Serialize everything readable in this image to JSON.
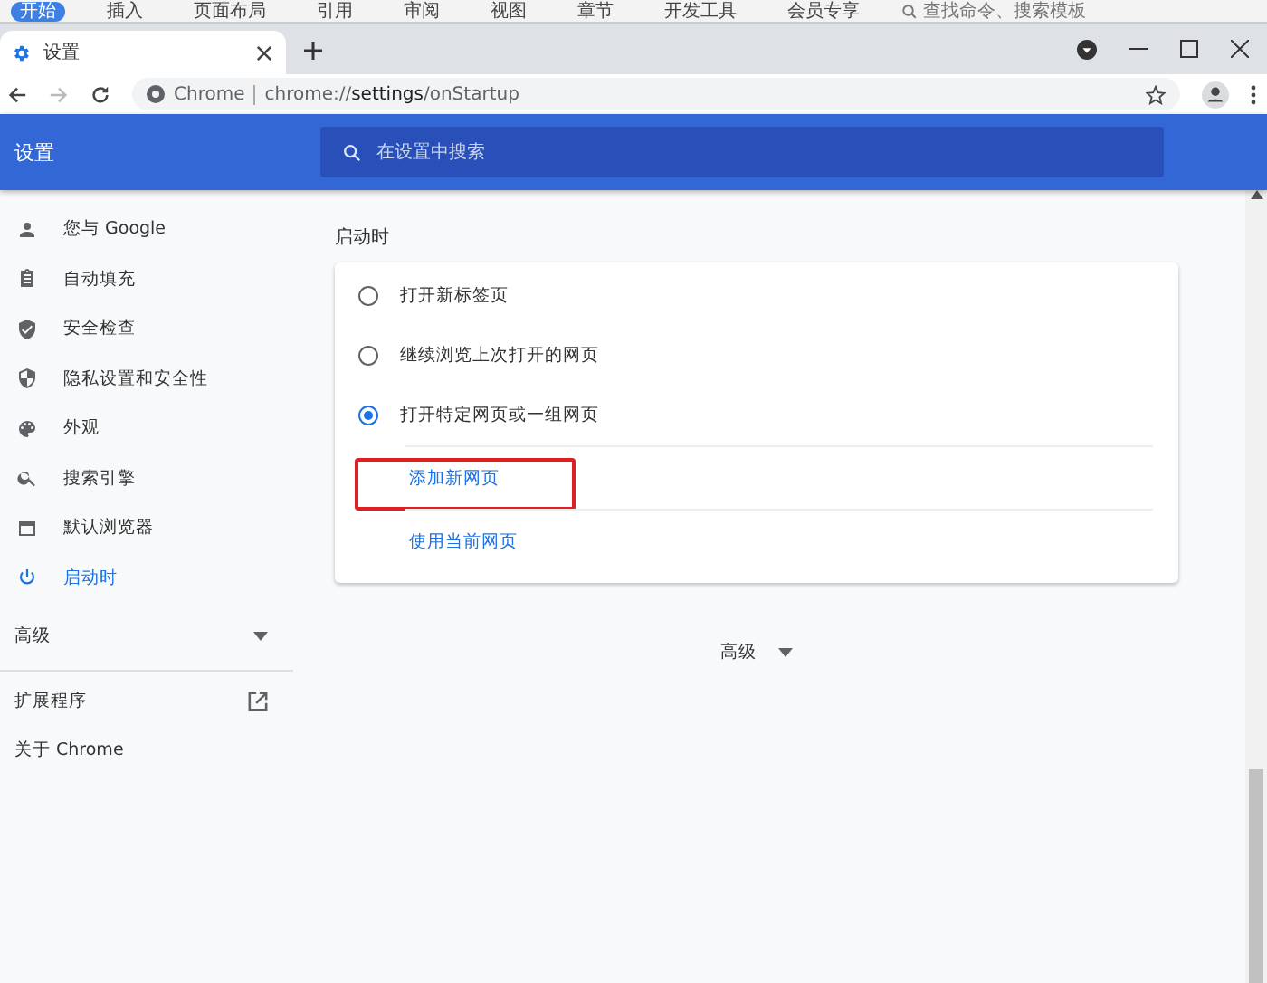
{
  "ribbon": {
    "tabs": [
      {
        "label": "开始",
        "selected": true
      },
      {
        "label": "插入",
        "selected": false
      },
      {
        "label": "页面布局",
        "selected": false
      },
      {
        "label": "引用",
        "selected": false
      },
      {
        "label": "审阅",
        "selected": false
      },
      {
        "label": "视图",
        "selected": false
      },
      {
        "label": "章节",
        "selected": false
      },
      {
        "label": "开发工具",
        "selected": false
      },
      {
        "label": "会员专享",
        "selected": false
      }
    ],
    "search": {
      "placeholder": "查找命令、搜索模板"
    }
  },
  "browser": {
    "tab": {
      "title": "设置"
    },
    "omnibox": {
      "site": "Chrome",
      "url": "chrome://**settings**/onStartup"
    },
    "forward_disabled": true
  },
  "header": {
    "title": "设置",
    "search": {
      "placeholder": "在设置中搜索"
    }
  },
  "sidebar": {
    "items": [
      {
        "label": "您与 Google",
        "selected": false
      },
      {
        "label": "自动填充",
        "selected": false
      },
      {
        "label": "安全检查",
        "selected": false
      },
      {
        "label": "隐私设置和安全性",
        "selected": false
      },
      {
        "label": "外观",
        "selected": false
      },
      {
        "label": "搜索引擎",
        "selected": false
      },
      {
        "label": "默认浏览器",
        "selected": false
      },
      {
        "label": "启动时",
        "selected": true
      }
    ],
    "advanced": {
      "label": "高级",
      "expanded": false
    },
    "extensions": "扩展程序",
    "about": "关于 Chrome"
  },
  "main": {
    "section_title": "启动时",
    "options": [
      {
        "label": "打开新标签页",
        "selected": false
      },
      {
        "label": "继续浏览上次打开的网页",
        "selected": false
      },
      {
        "label": "打开特定网页或一组网页",
        "selected": true
      }
    ],
    "links": [
      {
        "label": "添加新网页",
        "highlighted": true
      },
      {
        "label": "使用当前网页",
        "highlighted": false
      }
    ],
    "advanced": {
      "label": "高级",
      "expanded": false
    }
  }
}
